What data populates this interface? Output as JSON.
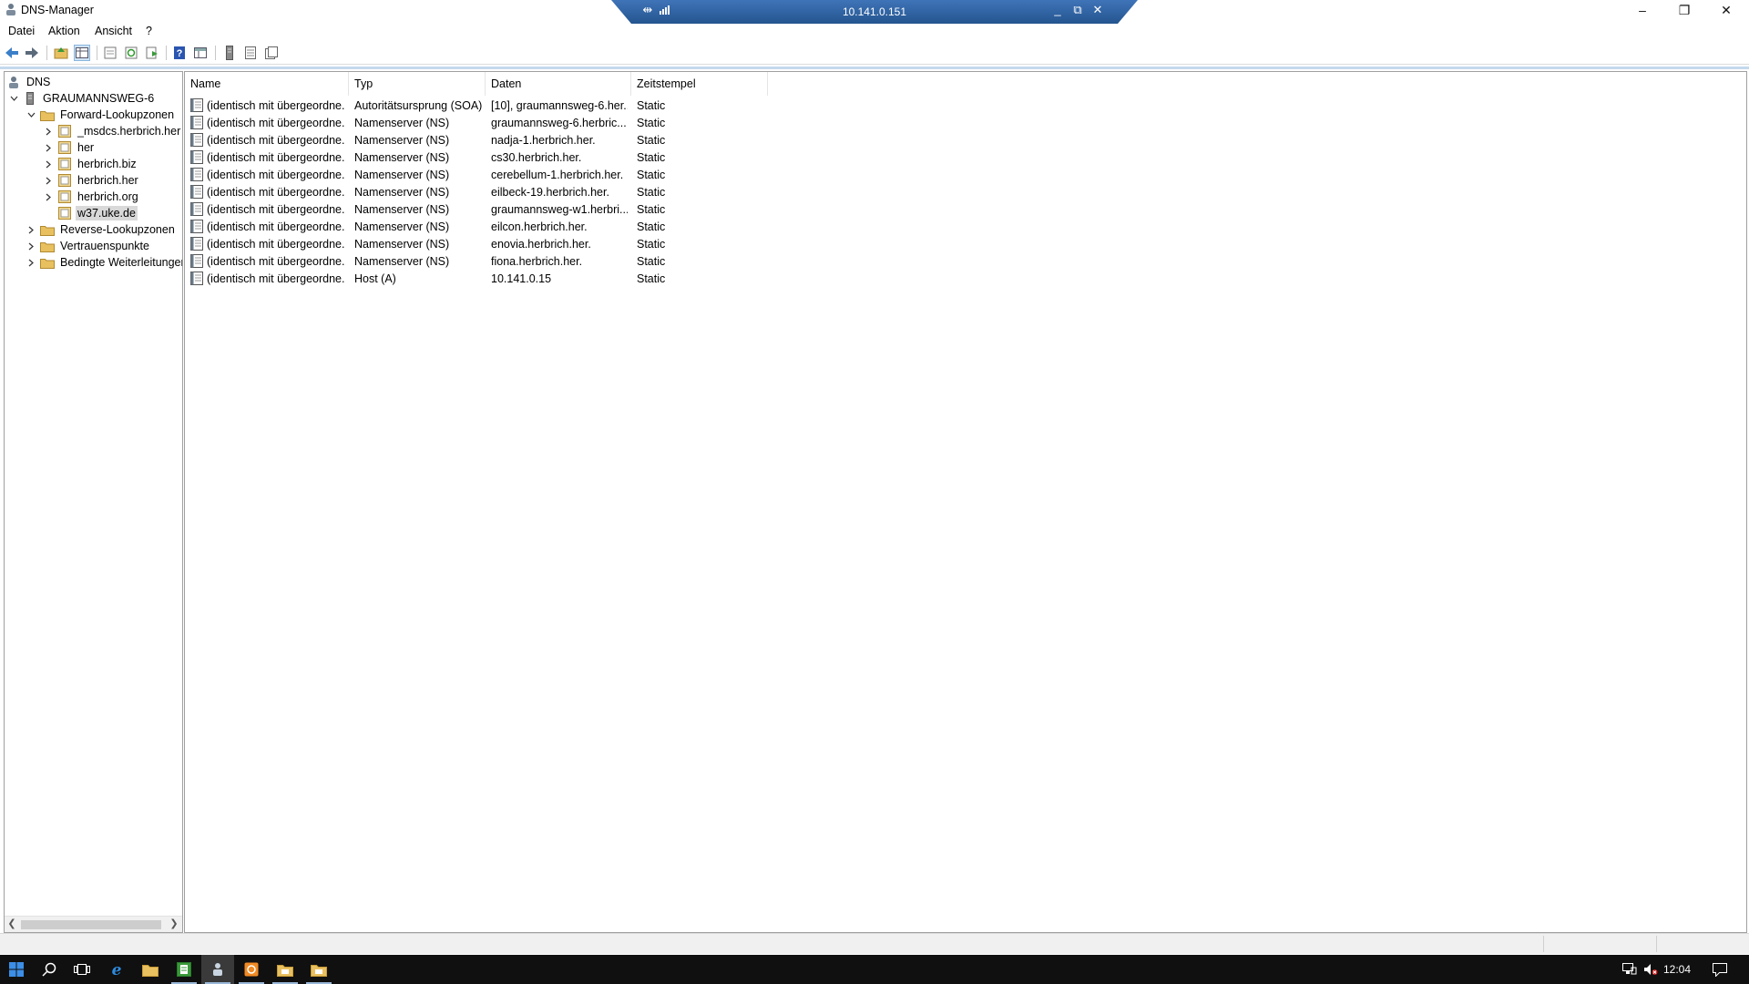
{
  "window": {
    "title": "DNS-Manager",
    "controls": {
      "minimize": "–",
      "restore": "❐",
      "close": "✕"
    }
  },
  "rdp_bar": {
    "host": "10.141.0.151",
    "pin_glyph": "⇹",
    "minimize": "_",
    "restore": "⧉",
    "close": "✕"
  },
  "menu": {
    "file": "Datei",
    "action": "Aktion",
    "view": "Ansicht",
    "help": "?"
  },
  "toolbar": {
    "icons": [
      "back-icon",
      "forward-icon",
      "up-folder-icon",
      "show-hide-tree-icon",
      "properties-icon",
      "refresh-icon",
      "export-list-icon",
      "help-icon",
      "view-options-icon",
      "server-icon",
      "record-list-icon",
      "record-properties-icon"
    ]
  },
  "tree": {
    "root": "DNS",
    "server": "GRAUMANNSWEG-6",
    "forward_zones": "Forward-Lookupzonen",
    "zones": [
      "_msdcs.herbrich.her",
      "her",
      "herbrich.biz",
      "herbrich.her",
      "herbrich.org",
      "w37.uke.de"
    ],
    "selected_zone": "w37.uke.de",
    "reverse_zones": "Reverse-Lookupzonen",
    "trust_points": "Vertrauenspunkte",
    "conditional_forwarders": "Bedingte Weiterleitungen"
  },
  "list": {
    "columns": [
      "Name",
      "Typ",
      "Daten",
      "Zeitstempel"
    ],
    "rows": [
      {
        "name": "(identisch mit übergeordne...",
        "type": "Autoritätsursprung (SOA)",
        "data": "[10], graumannsweg-6.her...",
        "timestamp": "Static"
      },
      {
        "name": "(identisch mit übergeordne...",
        "type": "Namenserver (NS)",
        "data": "graumannsweg-6.herbric...",
        "timestamp": "Static"
      },
      {
        "name": "(identisch mit übergeordne...",
        "type": "Namenserver (NS)",
        "data": "nadja-1.herbrich.her.",
        "timestamp": "Static"
      },
      {
        "name": "(identisch mit übergeordne...",
        "type": "Namenserver (NS)",
        "data": "cs30.herbrich.her.",
        "timestamp": "Static"
      },
      {
        "name": "(identisch mit übergeordne...",
        "type": "Namenserver (NS)",
        "data": "cerebellum-1.herbrich.her.",
        "timestamp": "Static"
      },
      {
        "name": "(identisch mit übergeordne...",
        "type": "Namenserver (NS)",
        "data": "eilbeck-19.herbrich.her.",
        "timestamp": "Static"
      },
      {
        "name": "(identisch mit übergeordne...",
        "type": "Namenserver (NS)",
        "data": "graumannsweg-w1.herbri...",
        "timestamp": "Static"
      },
      {
        "name": "(identisch mit übergeordne...",
        "type": "Namenserver (NS)",
        "data": "eilcon.herbrich.her.",
        "timestamp": "Static"
      },
      {
        "name": "(identisch mit übergeordne...",
        "type": "Namenserver (NS)",
        "data": "enovia.herbrich.her.",
        "timestamp": "Static"
      },
      {
        "name": "(identisch mit übergeordne...",
        "type": "Namenserver (NS)",
        "data": "fiona.herbrich.her.",
        "timestamp": "Static"
      },
      {
        "name": "(identisch mit übergeordne...",
        "type": "Host (A)",
        "data": "10.141.0.15",
        "timestamp": "Static"
      }
    ]
  },
  "taskbar": {
    "apps": [
      "start-icon",
      "search-icon",
      "task-view-icon",
      "internet-explorer-icon",
      "file-explorer-icon",
      "server-manager-icon",
      "dns-manager-icon",
      "app-orange-icon",
      "folder-icon",
      "folder-icon-2"
    ],
    "active_app": "dns-manager-icon",
    "clock": "12:04"
  },
  "colors": {
    "rdp_bar": "#2f62a6",
    "accent_line": "#c4d9ec",
    "taskbar": "#101010",
    "folder": "#e8c060"
  }
}
